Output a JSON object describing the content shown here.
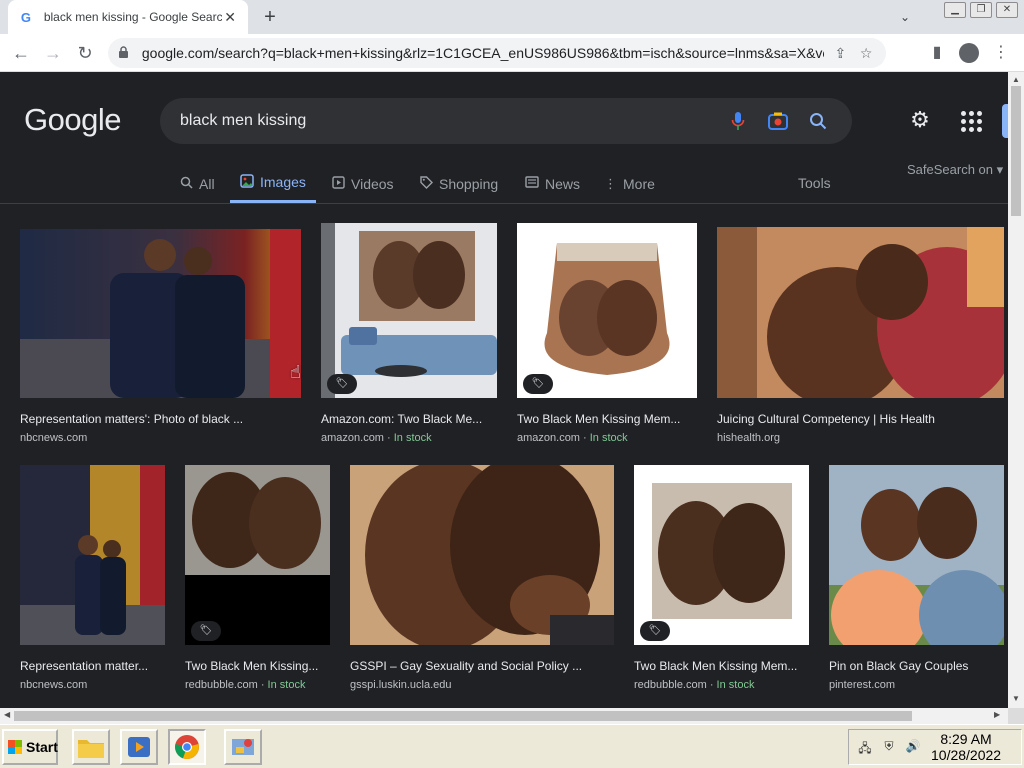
{
  "browser": {
    "tab_title": "black men kissing - Google Searc",
    "favicon_letter": "G",
    "url": "google.com/search?q=black+men+kissing&rlz=1C1GCEA_enUS986US986&tbm=isch&source=lnms&sa=X&ved..."
  },
  "google": {
    "logo": "Google",
    "query": "black men kissing",
    "tabs": [
      {
        "label": "All",
        "icon": "search-icon"
      },
      {
        "label": "Images",
        "icon": "image-icon"
      },
      {
        "label": "Videos",
        "icon": "play-icon"
      },
      {
        "label": "Shopping",
        "icon": "tag-icon"
      },
      {
        "label": "News",
        "icon": "newspaper-icon"
      },
      {
        "label": "More",
        "icon": "more-vert-icon"
      }
    ],
    "tools_label": "Tools",
    "safesearch_label": "SafeSearch on"
  },
  "results_row1": [
    {
      "caption": "Representation matters': Photo of black ...",
      "source": "nbcnews.com",
      "stock": ""
    },
    {
      "caption": "Amazon.com: Two Black Me...",
      "source": "amazon.com · ",
      "stock": "In stock"
    },
    {
      "caption": "Two Black Men Kissing Mem...",
      "source": "amazon.com · ",
      "stock": "In stock"
    },
    {
      "caption": "Juicing Cultural Competency | His Health",
      "source": "hishealth.org",
      "stock": ""
    }
  ],
  "results_row2": [
    {
      "caption": "Representation matter...",
      "source": "nbcnews.com",
      "stock": ""
    },
    {
      "caption": "Two Black Men Kissing...",
      "source": "redbubble.com · ",
      "stock": "In stock"
    },
    {
      "caption": "GSSPI – Gay Sexuality and Social Policy ...",
      "source": "gsspi.luskin.ucla.edu",
      "stock": ""
    },
    {
      "caption": "Two Black Men Kissing Mem...",
      "source": "redbubble.com · ",
      "stock": "In stock"
    },
    {
      "caption": "Pin on Black Gay Couples",
      "source": "pinterest.com",
      "stock": ""
    }
  ],
  "taskbar": {
    "start_label": "Start",
    "time": "8:29 AM",
    "date": "10/28/2022"
  },
  "colors": {
    "page_bg": "#202124",
    "accent": "#8ab4f8",
    "in_stock": "#81c995"
  }
}
